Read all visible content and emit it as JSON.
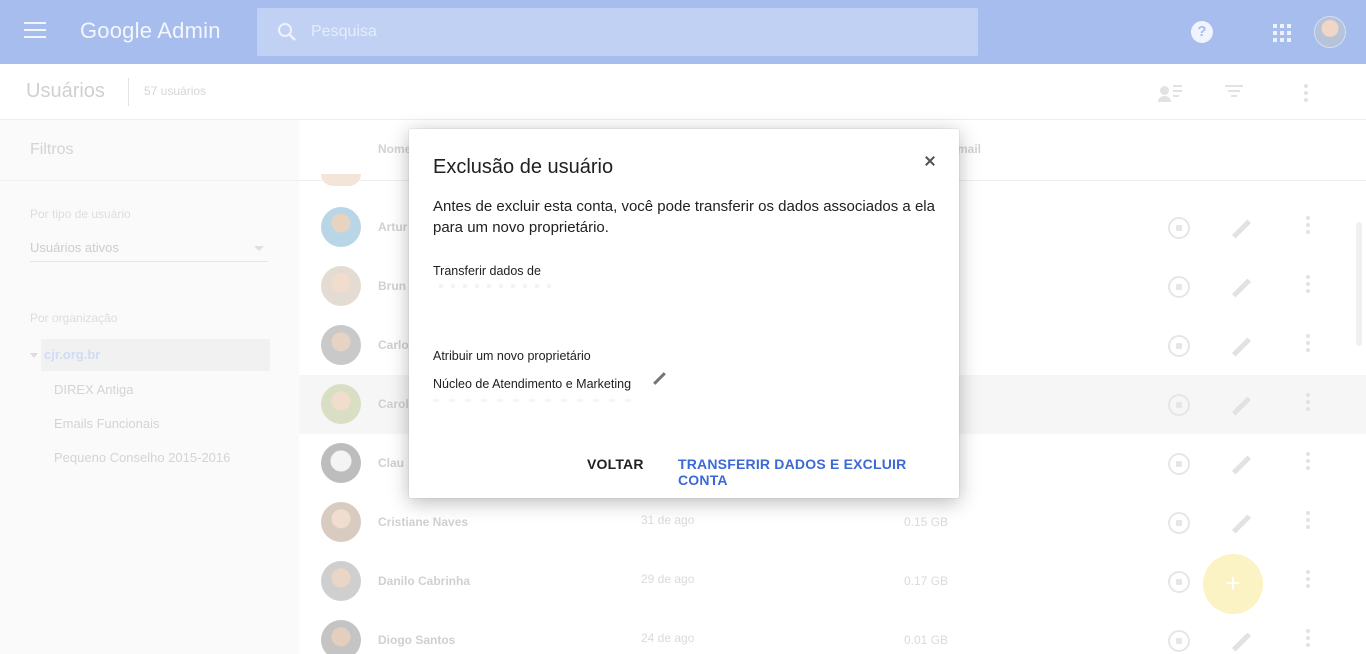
{
  "appbar": {
    "logo_google": "Google",
    "logo_admin": "Admin",
    "search_placeholder": "Pesquisa",
    "help_glyph": "?"
  },
  "header": {
    "title": "Usuários",
    "count": "57 usuários"
  },
  "sidebar": {
    "title": "Filtros",
    "user_type_label": "Por tipo de usuário",
    "user_type_value": "Usuários ativos",
    "org_label": "Por organização",
    "org_root": "cjr.org.br",
    "org_children": [
      "DIREX Antiga",
      "Emails Funcionais",
      "Pequeno Conselho 2015-2016"
    ]
  },
  "list": {
    "col_name": "Nome",
    "col_email_partial": "mail",
    "rows": [
      {
        "name": "Artur",
        "login": "",
        "storage": ""
      },
      {
        "name": "Brun",
        "login": "",
        "storage": ""
      },
      {
        "name": "Carlo",
        "login": "",
        "storage": ""
      },
      {
        "name": "Carol",
        "login": "",
        "storage": ""
      },
      {
        "name": "Clau",
        "login": "",
        "storage": ""
      },
      {
        "name": "Cristiane Naves",
        "login": "31 de ago",
        "storage": "0.15 GB"
      },
      {
        "name": "Danilo Cabrinha",
        "login": "29 de ago",
        "storage": "0.17 GB"
      },
      {
        "name": "Diogo Santos",
        "login": "24 de ago",
        "storage": "0.01 GB"
      }
    ],
    "fab_glyph": "+"
  },
  "dialog": {
    "title": "Exclusão de usuário",
    "body": "Antes de excluir esta conta, você pode transferir os dados associados a ela para um novo proprietário.",
    "transfer_from_label": "Transferir dados de",
    "new_owner_label": "Atribuir um novo proprietário",
    "new_owner_value": "Núcleo de Atendimento e Marketing",
    "back_button": "VOLTAR",
    "transfer_button": "TRANSFERIR DADOS E EXCLUIR CONTA"
  },
  "colors": {
    "appbar": "#a6bdee",
    "primary_action": "#3b6ad6",
    "fab": "#fbf3c3"
  },
  "icons": [
    "menu-icon",
    "search-icon",
    "help-icon",
    "apps-icon",
    "user-filter-icon",
    "filter-icon",
    "more-vert-icon",
    "restore-icon",
    "edit-icon",
    "close-icon",
    "add-icon"
  ]
}
